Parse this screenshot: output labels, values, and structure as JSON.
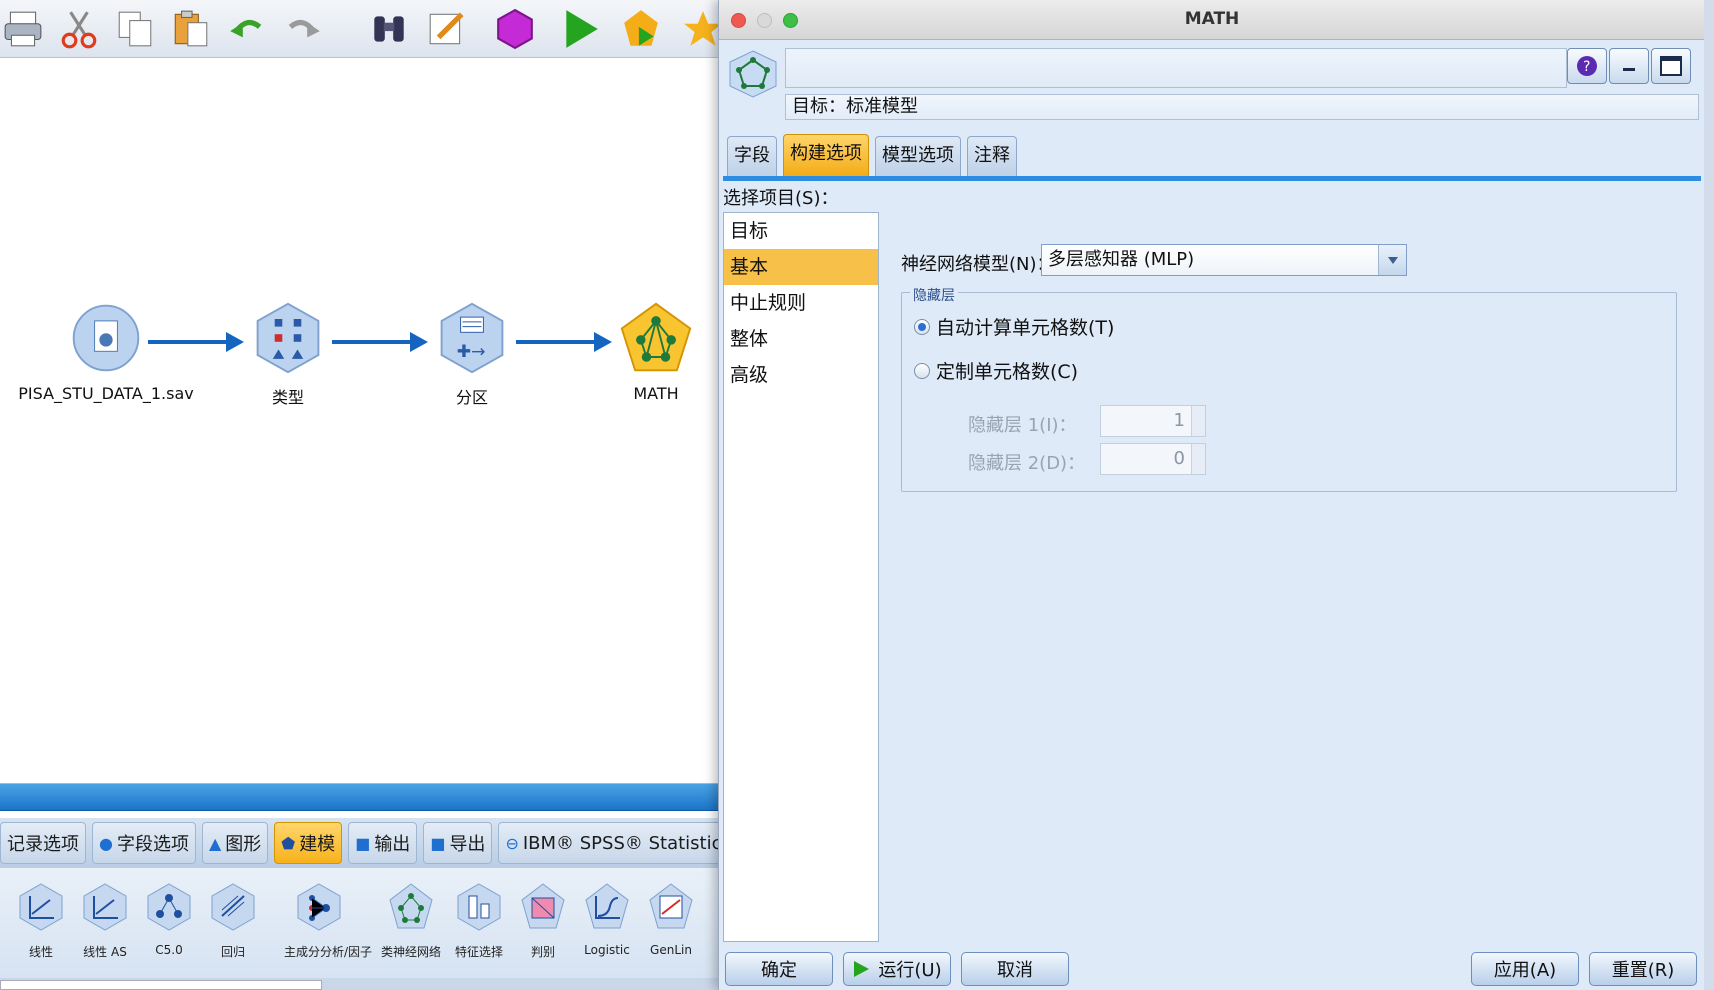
{
  "app": {
    "canvas_nodes": [
      {
        "label": "PISA_STU_DATA_1.sav"
      },
      {
        "label": "类型"
      },
      {
        "label": "分区"
      },
      {
        "label": "MATH"
      }
    ],
    "palette_tabs": [
      {
        "label": "记录选项"
      },
      {
        "label": "字段选项"
      },
      {
        "label": "图形"
      },
      {
        "label": "建模"
      },
      {
        "label": "输出"
      },
      {
        "label": "导出"
      },
      {
        "label": "IBM® SPSS® Statistic"
      }
    ],
    "palette_nodes": [
      {
        "label": "线性"
      },
      {
        "label": "线性 AS"
      },
      {
        "label": "C5.0"
      },
      {
        "label": "回归"
      },
      {
        "label": "主成分分析/因子"
      },
      {
        "label": "类神经网络"
      },
      {
        "label": "特征选择"
      },
      {
        "label": "判别"
      },
      {
        "label": "Logistic"
      },
      {
        "label": "GenLin"
      }
    ]
  },
  "dialog": {
    "title": "MATH",
    "target": "目标：标准模型",
    "tabs": [
      {
        "label": "字段"
      },
      {
        "label": "构建选项"
      },
      {
        "label": "模型选项"
      },
      {
        "label": "注释"
      }
    ],
    "select_label": "选择项目(S)：",
    "items": [
      {
        "label": "目标"
      },
      {
        "label": "基本"
      },
      {
        "label": "中止规则"
      },
      {
        "label": "整体"
      },
      {
        "label": "高级"
      }
    ],
    "model_label": "神经网络模型(N)：",
    "model_value": "多层感知器 (MLP)",
    "hidden_group_label": "隐藏层",
    "radio_auto": "自动计算单元格数(T)",
    "radio_custom": "定制单元格数(C)",
    "hidden1_label": "隐藏层 1(I)：",
    "hidden1_value": "1",
    "hidden2_label": "隐藏层 2(D)：",
    "hidden2_value": "0",
    "buttons": {
      "ok": "确定",
      "run": "运行(U)",
      "cancel": "取消",
      "apply": "应用(A)",
      "reset": "重置(R)"
    }
  },
  "colors": {
    "accent_orange": "#f4ac17",
    "flow_blue": "#1565c0",
    "dialog_bg": "#deeaf7"
  }
}
